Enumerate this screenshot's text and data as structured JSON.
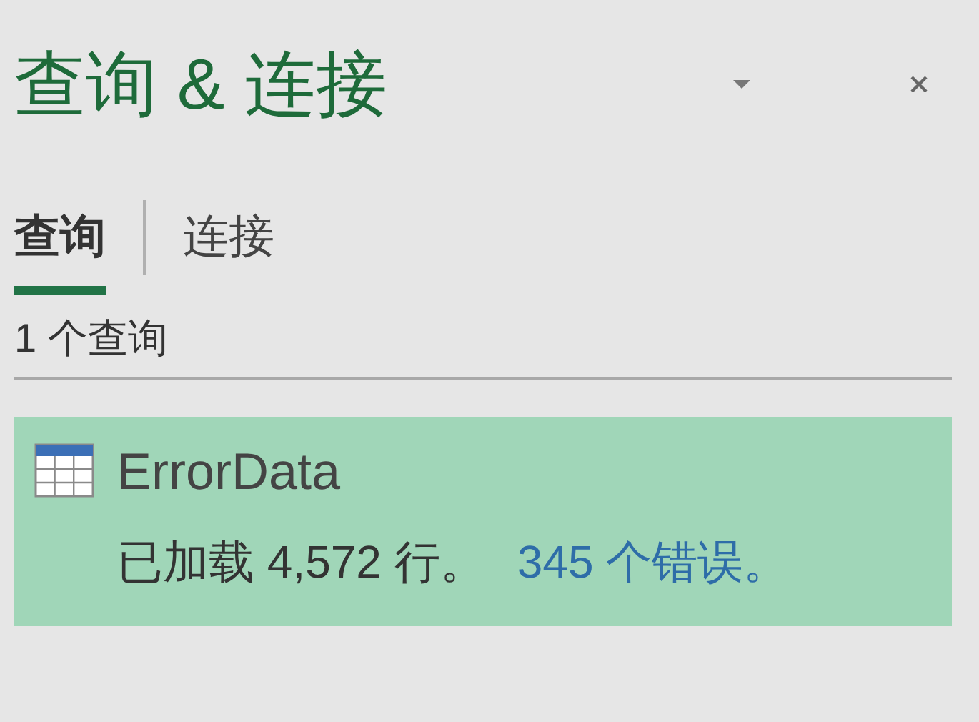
{
  "pane": {
    "title": "查询 & 连接"
  },
  "tabs": [
    {
      "label": "查询",
      "selected": true
    },
    {
      "label": "连接",
      "selected": false
    }
  ],
  "query_count": "1 个查询",
  "queries": [
    {
      "name": "ErrorData",
      "status": "已加载 4,572 行。",
      "errors_link": "345 个错误。",
      "selected": true
    }
  ]
}
